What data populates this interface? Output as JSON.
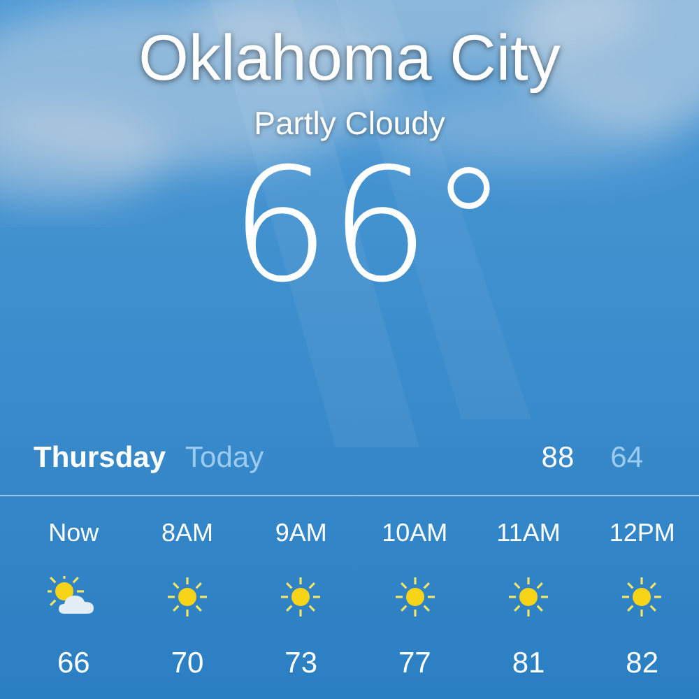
{
  "location": {
    "city": "Oklahoma City",
    "condition": "Partly Cloudy",
    "temperature": "66°"
  },
  "day_summary": {
    "day": "Thursday",
    "label": "Today",
    "high": "88",
    "low": "64"
  },
  "hourly": [
    {
      "time": "Now",
      "kind": "partly_cloudy",
      "temp": "66"
    },
    {
      "time": "8AM",
      "kind": "sunny",
      "temp": "70"
    },
    {
      "time": "9AM",
      "kind": "sunny",
      "temp": "73"
    },
    {
      "time": "10AM",
      "kind": "sunny",
      "temp": "77"
    },
    {
      "time": "11AM",
      "kind": "sunny",
      "temp": "81"
    },
    {
      "time": "12PM",
      "kind": "sunny",
      "temp": "82"
    }
  ]
}
